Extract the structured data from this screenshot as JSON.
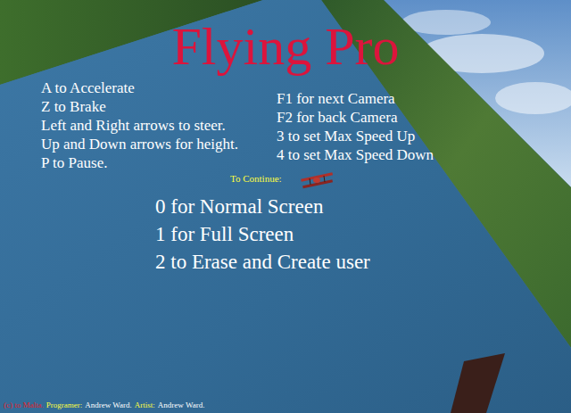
{
  "title": "Flying Pro",
  "controls": [
    "A to Accelerate",
    "Z to Brake",
    "Left and Right arrows to steer.",
    "Up and Down arrows for height.",
    "P to Pause."
  ],
  "camera_controls": [
    "F1 for next Camera",
    "F2 for back Camera",
    "3 to set Max Speed Up",
    "4 to set Max Speed Down"
  ],
  "prompt": "To Continue:",
  "options": [
    "0 for Normal Screen",
    "1 for Full Screen",
    "2 to Erase and Create user"
  ],
  "credits": [
    {
      "text": "(c) to Malta.",
      "color": "#e0202a"
    },
    {
      "text": "Programer:",
      "color": "#ffff40"
    },
    {
      "text": "Andrew Ward.",
      "color": "#ffffff"
    },
    {
      "text": "Artist:",
      "color": "#ffff40"
    },
    {
      "text": "Andrew Ward.",
      "color": "#ffffff"
    }
  ]
}
